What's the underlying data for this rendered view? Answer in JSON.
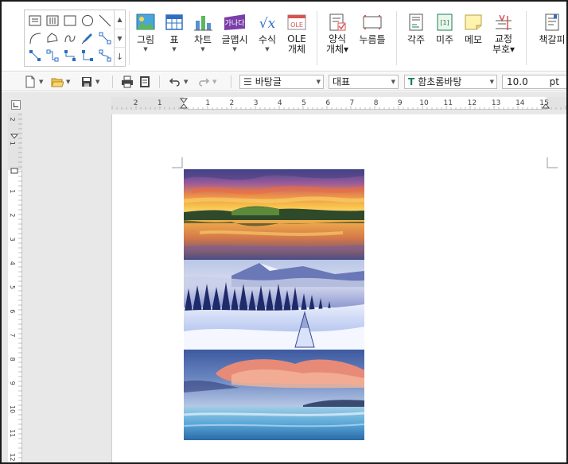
{
  "ribbon": {
    "buttons": [
      {
        "id": "picture",
        "label": "그림",
        "icon": "picture-icon",
        "has_dropdown": true
      },
      {
        "id": "table",
        "label": "표",
        "icon": "table-icon",
        "has_dropdown": true
      },
      {
        "id": "chart",
        "label": "차트",
        "icon": "chart-icon",
        "has_dropdown": true
      },
      {
        "id": "wordart",
        "label": "글맵시",
        "icon": "wordart-icon",
        "icon_text": "가나다",
        "has_dropdown": true
      },
      {
        "id": "equation",
        "label": "수식",
        "icon": "equation-icon",
        "icon_text": "√x",
        "has_dropdown": true
      },
      {
        "id": "ole",
        "label": "OLE\n개체",
        "icon": "ole-icon",
        "icon_text": "OLE",
        "has_dropdown": false
      },
      {
        "id": "form",
        "label": "양식\n개체",
        "icon": "form-object-icon",
        "has_dropdown": true
      },
      {
        "id": "pushbutton",
        "label": "누름틀",
        "icon": "field-icon",
        "has_dropdown": false
      },
      {
        "id": "footnote",
        "label": "각주",
        "icon": "footnote-icon",
        "has_dropdown": false
      },
      {
        "id": "endnote",
        "label": "미주",
        "icon": "endnote-icon",
        "icon_text": "[1]",
        "has_dropdown": false
      },
      {
        "id": "memo",
        "label": "메모",
        "icon": "memo-icon",
        "has_dropdown": false
      },
      {
        "id": "proofmark",
        "label": "교정\n부호",
        "icon": "proofreading-icon",
        "has_dropdown": true
      },
      {
        "id": "bookmark",
        "label": "책갈피",
        "icon": "bookmark-icon",
        "has_dropdown": false
      }
    ],
    "shape_gallery": {
      "items": [
        "textbox-icon",
        "vertical-textbox-icon",
        "rectangle-icon",
        "ellipse-icon",
        "line-icon",
        "arc-icon",
        "polygon-icon",
        "curve-icon",
        "pen-icon",
        "connector-line-icon",
        "connector-straight-icon",
        "connector-elbow-icon",
        "connector-step-icon",
        "connector-bent-icon",
        "connector-curved-icon"
      ],
      "scroll_up": "▲",
      "scroll_down": "▼",
      "expand": "↓"
    }
  },
  "toolbar": {
    "style_value": "바탕글",
    "lang_value": "대표",
    "font_value": "함초롬바탕",
    "font_icon": "T",
    "size_value": "10.0",
    "size_unit": "pt",
    "caret": "▼"
  },
  "ruler": {
    "h_labels": [
      "2",
      "1",
      "1",
      "2",
      "3",
      "4",
      "5",
      "6",
      "7",
      "8",
      "9",
      "10",
      "11",
      "12",
      "13",
      "14",
      "15"
    ],
    "v_labels": [
      "2",
      "1",
      "1",
      "2",
      "3",
      "4",
      "5",
      "6",
      "7",
      "8",
      "9",
      "10",
      "11",
      "12"
    ]
  },
  "document": {
    "images": [
      "sunset-lake-photo",
      "snowy-forest-photo",
      "sea-sunset-photo"
    ]
  },
  "colors": {
    "ribbon_bg": "#ffffff",
    "toolbar_bg": "#f7f7f7",
    "workspace_bg": "#e8e8e8",
    "page_bg": "#ffffff",
    "icon_blue": "#2f6fc0",
    "icon_purple": "#7b3fa8"
  }
}
